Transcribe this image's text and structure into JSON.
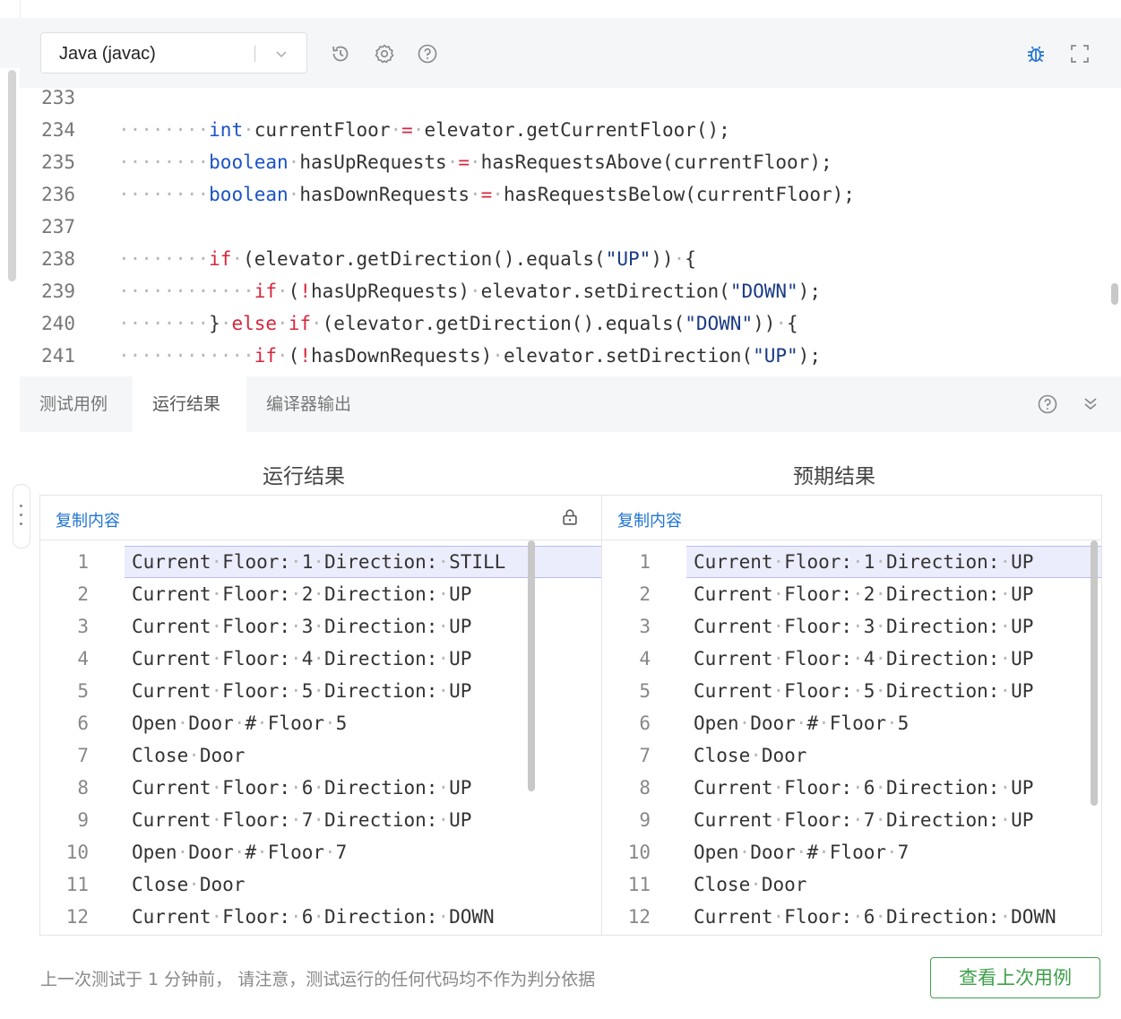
{
  "toolbar": {
    "language": "Java (javac)",
    "icons": [
      "history-icon",
      "gear-icon",
      "help-icon",
      "bug-icon",
      "fullscreen-icon"
    ]
  },
  "editor": {
    "lines": [
      {
        "n": "233",
        "html": ""
      },
      {
        "n": "234",
        "html": "<span class='dot'>········</span><span class='kw'>int</span><span class='dot'>·</span>currentFloor<span class='dot'>·</span><span class='kwr'>=</span><span class='dot'>·</span>elevator.getCurrentFloor();"
      },
      {
        "n": "235",
        "html": "<span class='dot'>········</span><span class='kw'>boolean</span><span class='dot'>·</span>hasUpRequests<span class='dot'>·</span><span class='kwr'>=</span><span class='dot'>·</span>hasRequestsAbove(currentFloor);"
      },
      {
        "n": "236",
        "html": "<span class='dot'>········</span><span class='kw'>boolean</span><span class='dot'>·</span>hasDownRequests<span class='dot'>·</span><span class='kwr'>=</span><span class='dot'>·</span>hasRequestsBelow(currentFloor);"
      },
      {
        "n": "237",
        "html": ""
      },
      {
        "n": "238",
        "html": "<span class='dot'>········</span><span class='kwr'>if</span><span class='dot'>·</span>(elevator.getDirection().equals(<span class='str'>\"UP\"</span>))<span class='dot'>·</span>{"
      },
      {
        "n": "239",
        "html": "<span class='dot'>············</span><span class='kwr'>if</span><span class='dot'>·</span>(<span class='kwr'>!</span>hasUpRequests)<span class='dot'>·</span>elevator.setDirection(<span class='str'>\"DOWN\"</span>);"
      },
      {
        "n": "240",
        "html": "<span class='dot'>········</span>}<span class='dot'>·</span><span class='kwr'>else</span><span class='dot'>·</span><span class='kwr'>if</span><span class='dot'>·</span>(elevator.getDirection().equals(<span class='str'>\"DOWN\"</span>))<span class='dot'>·</span>{"
      },
      {
        "n": "241",
        "html": "<span class='dot'>············</span><span class='kwr'>if</span><span class='dot'>·</span>(<span class='kwr'>!</span>hasDownRequests)<span class='dot'>·</span>elevator.setDirection(<span class='str'>\"UP\"</span>);"
      }
    ]
  },
  "tabs": [
    {
      "label": "测试用例",
      "active": false
    },
    {
      "label": "运行结果",
      "active": true
    },
    {
      "label": "编译器输出",
      "active": false
    }
  ],
  "results": {
    "left_title": "运行结果",
    "right_title": "预期结果",
    "copy_label": "复制内容",
    "actual": [
      "Current·Floor:·1·Direction:·STILL",
      "Current·Floor:·2·Direction:·UP",
      "Current·Floor:·3·Direction:·UP",
      "Current·Floor:·4·Direction:·UP",
      "Current·Floor:·5·Direction:·UP",
      "Open·Door·#·Floor·5",
      "Close·Door",
      "Current·Floor:·6·Direction:·UP",
      "Current·Floor:·7·Direction:·UP",
      "Open·Door·#·Floor·7",
      "Close·Door",
      "Current·Floor:·6·Direction:·DOWN"
    ],
    "expected": [
      "Current·Floor:·1·Direction:·UP",
      "Current·Floor:·2·Direction:·UP",
      "Current·Floor:·3·Direction:·UP",
      "Current·Floor:·4·Direction:·UP",
      "Current·Floor:·5·Direction:·UP",
      "Open·Door·#·Floor·5",
      "Close·Door",
      "Current·Floor:·6·Direction:·UP",
      "Current·Floor:·7·Direction:·UP",
      "Open·Door·#·Floor·7",
      "Close·Door",
      "Current·Floor:·6·Direction:·DOWN"
    ]
  },
  "footer": {
    "note": "上一次测试于 1 分钟前， 请注意，测试运行的任何代码均不作为判分依据",
    "button": "查看上次用例"
  },
  "colors": {
    "accent_blue": "#1f74d2",
    "green": "#3fa04a",
    "highlight": "#ecedfc"
  }
}
